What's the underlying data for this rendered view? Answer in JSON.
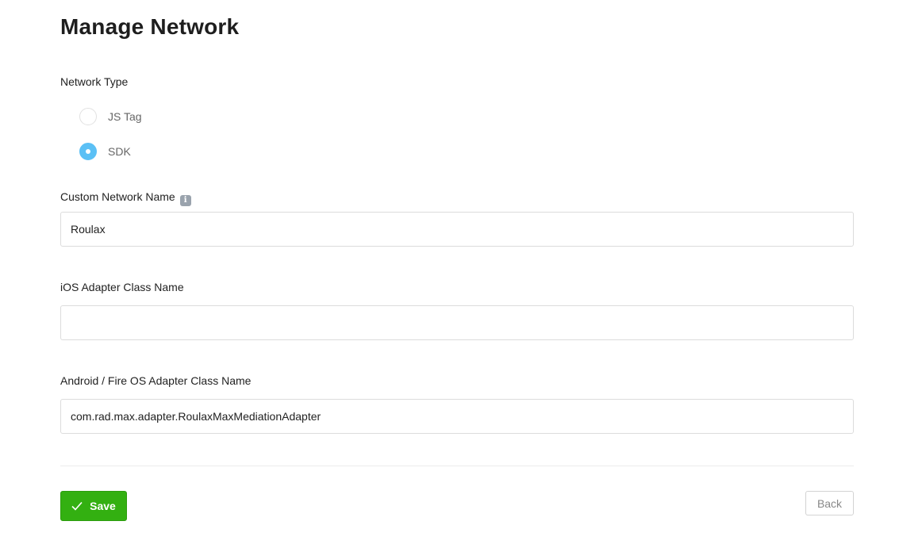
{
  "page": {
    "title": "Manage Network"
  },
  "network_type": {
    "label": "Network Type",
    "options": [
      {
        "label": "JS Tag",
        "checked": false
      },
      {
        "label": "SDK",
        "checked": true
      }
    ]
  },
  "custom_network_name": {
    "label": "Custom Network Name",
    "info_icon": "i",
    "value": "Roulax"
  },
  "ios_adapter": {
    "label": "iOS Adapter Class Name",
    "value": ""
  },
  "android_adapter": {
    "label": "Android / Fire OS Adapter Class Name",
    "value": "com.rad.max.adapter.RoulaxMaxMediationAdapter"
  },
  "actions": {
    "save_label": "Save",
    "back_label": "Back"
  },
  "colors": {
    "save_button": "#33b011",
    "radio_checked": "#5bc0f5",
    "info_icon": "#9aa3ad"
  },
  "icons": {
    "save": "checkmark-icon",
    "info": "info-icon"
  }
}
